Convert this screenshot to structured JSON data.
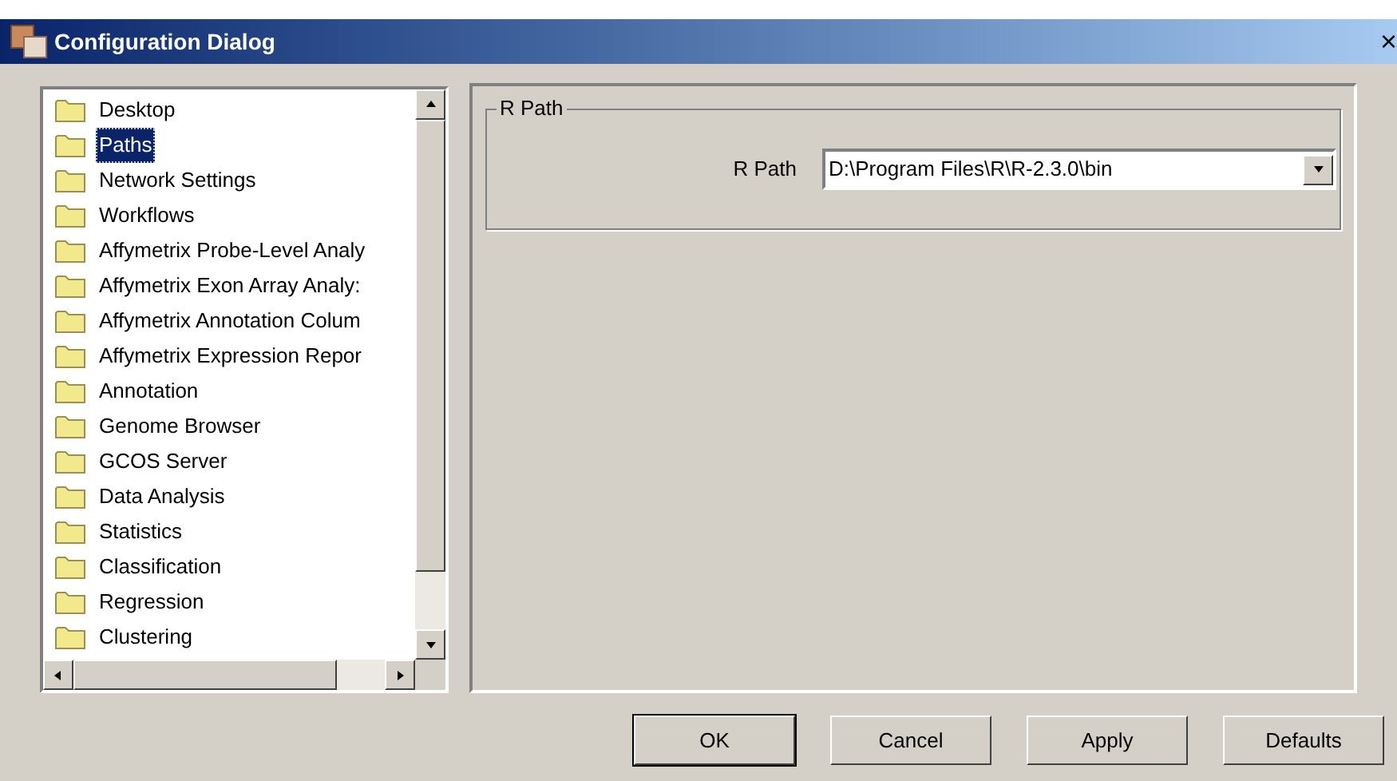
{
  "window": {
    "title": "Configuration Dialog",
    "close": "×"
  },
  "sidebar": {
    "items": [
      {
        "label": "Desktop",
        "selected": false
      },
      {
        "label": "Paths",
        "selected": true
      },
      {
        "label": "Network Settings",
        "selected": false
      },
      {
        "label": "Workflows",
        "selected": false
      },
      {
        "label": "Affymetrix Probe-Level Analy",
        "selected": false
      },
      {
        "label": "Affymetrix Exon Array Analy:",
        "selected": false
      },
      {
        "label": "Affymetrix Annotation Colum",
        "selected": false
      },
      {
        "label": "Affymetrix Expression Repor",
        "selected": false
      },
      {
        "label": "Annotation",
        "selected": false
      },
      {
        "label": "Genome Browser",
        "selected": false
      },
      {
        "label": "GCOS Server",
        "selected": false
      },
      {
        "label": "Data Analysis",
        "selected": false
      },
      {
        "label": "Statistics",
        "selected": false
      },
      {
        "label": "Classification",
        "selected": false
      },
      {
        "label": "Regression",
        "selected": false
      },
      {
        "label": "Clustering",
        "selected": false
      }
    ]
  },
  "group": {
    "title": "R Path",
    "label": "R Path",
    "value": "D:\\Program Files\\R\\R-2.3.0\\bin"
  },
  "buttons": [
    "OK",
    "Cancel",
    "Apply",
    "Defaults"
  ]
}
